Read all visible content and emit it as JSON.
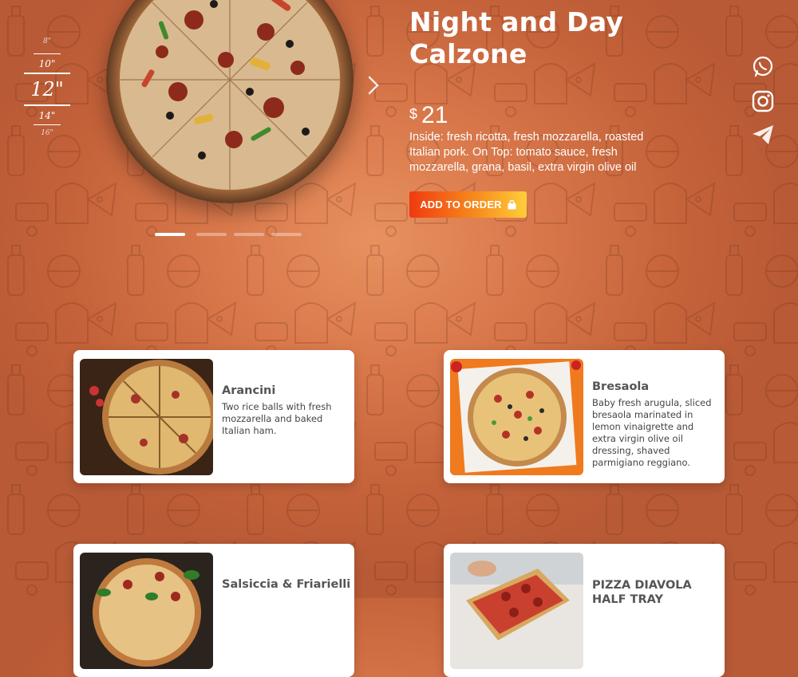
{
  "hero": {
    "title_line1": "Night and Day",
    "title_line2": "Calzone",
    "currency": "$",
    "price": "21",
    "description": "Inside: fresh ricotta, fresh mozzarella, roasted Italian pork. On Top: tomato sauce, fresh mozzarella, grana, basil, extra virgin olive oil",
    "add_button_label": "ADD TO ORDER",
    "button_icon": "shopping-bag-icon"
  },
  "sizes": [
    {
      "label": "8\""
    },
    {
      "label": "10\""
    },
    {
      "label": "12\"",
      "selected": true
    },
    {
      "label": "14\""
    },
    {
      "label": "16\""
    }
  ],
  "carousel": {
    "slides": 4,
    "active_slide": 1,
    "next_icon": "chevron-right-icon"
  },
  "socials": [
    {
      "icon": "whatsapp-icon"
    },
    {
      "icon": "instagram-icon"
    },
    {
      "icon": "telegram-icon"
    }
  ],
  "menu_items": [
    {
      "name": "Arancini",
      "description": "Two rice balls with fresh mozzarella and baked Italian ham."
    },
    {
      "name": "Bresaola",
      "description": "Baby fresh arugula, sliced bresaola marinated in lemon vinaigrette and extra virgin olive oil dressing, shaved parmigiano reggiano."
    },
    {
      "name": "Salsiccia & Friarielli",
      "description": ""
    },
    {
      "name": "PIZZA DIAVOLA HALF TRAY",
      "description": ""
    }
  ],
  "colors": {
    "accent_start": "#f03a10",
    "accent_end": "#ffce3b",
    "background": "#d8774a"
  }
}
